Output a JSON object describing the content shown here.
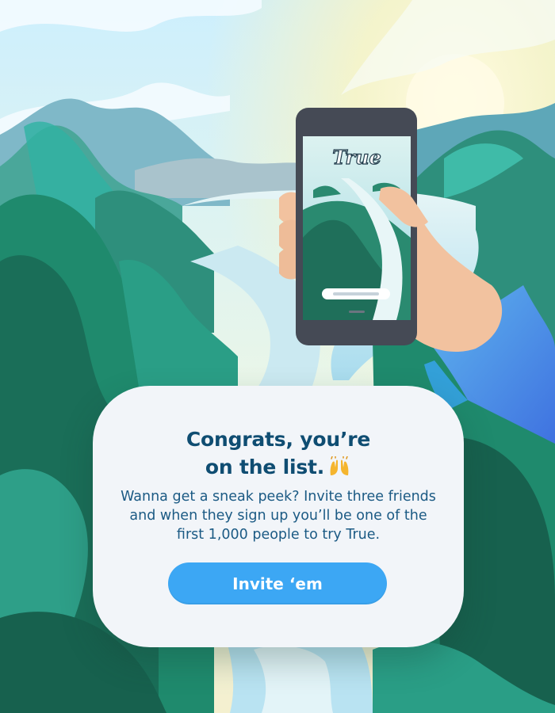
{
  "illustration": {
    "phone_app_logo": "True"
  },
  "card": {
    "title_line1": "Congrats, you’re",
    "title_line2": "on the list.",
    "emoji": "raised-hands-icon",
    "body": "Wanna get a sneak peek? Invite three friends and when they sign up you’ll be one of the first 1,000 people to try True.",
    "button_label": "Invite ‘em"
  },
  "colors": {
    "title": "#0f4d72",
    "body": "#1b5a84",
    "button": "#3ca7f4",
    "card": "#f2f5f9"
  }
}
